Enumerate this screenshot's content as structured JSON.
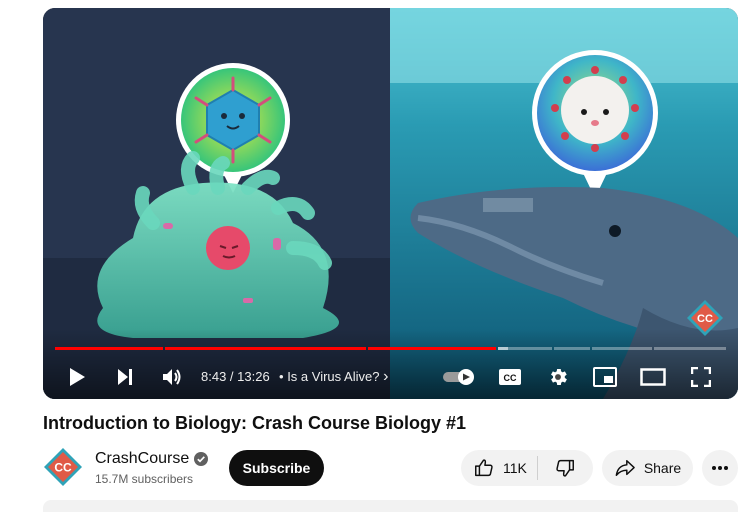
{
  "player": {
    "current_time": "8:43",
    "duration": "13:26",
    "time_separator": " / ",
    "chapter_bullet": "•",
    "chapter_title": "Is a Virus Alive?",
    "chapter_chevron": "›",
    "progress_fraction": 0.649,
    "captions_label": "CC",
    "watermark_text": "CC",
    "accent_color": "#ff0000"
  },
  "video": {
    "title": "Introduction to Biology: Crash Course Biology #1"
  },
  "channel": {
    "name": "CrashCourse",
    "subscribers": "15.7M subscribers",
    "avatar_text": "CC",
    "avatar_color": "#e05a47"
  },
  "actions": {
    "subscribe_label": "Subscribe",
    "like_count": "11K",
    "share_label": "Share"
  },
  "icons": {
    "play": "play-icon",
    "next": "next-icon",
    "volume": "volume-icon",
    "autoplay": "autoplay-toggle-icon",
    "captions": "captions-icon",
    "settings": "gear-icon",
    "miniplayer": "miniplayer-icon",
    "theater": "theater-icon",
    "fullscreen": "fullscreen-icon",
    "like": "thumbs-up-icon",
    "dislike": "thumbs-down-icon",
    "share": "share-icon",
    "more": "more-icon",
    "verified": "verified-check-icon"
  }
}
